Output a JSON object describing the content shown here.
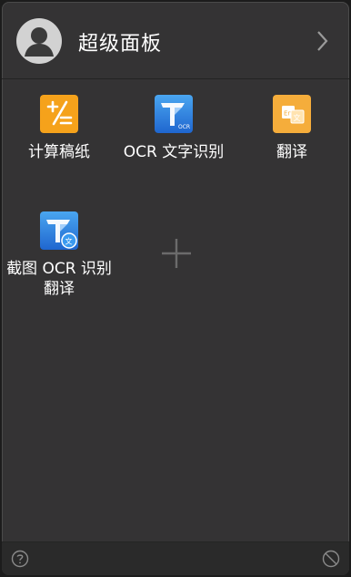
{
  "header": {
    "title": "超级面板"
  },
  "tiles": [
    {
      "label": "计算稿纸",
      "icon": "calculator-icon",
      "color": "#f5a21b"
    },
    {
      "label": "OCR 文字识别",
      "icon": "ocr-text-icon",
      "color": "#2a7fde"
    },
    {
      "label": "翻译",
      "icon": "translate-icon",
      "color": "#f5ad3b"
    },
    {
      "label": "截图 OCR 识别翻译",
      "icon": "screenshot-ocr-translate-icon",
      "color": "#2a7fde"
    }
  ],
  "ocr_badge": "OCR",
  "add_button": {
    "icon": "plus-icon"
  },
  "footer": {
    "help_icon": "question-icon",
    "disable_icon": "ban-icon"
  },
  "colors": {
    "panel_bg": "#343334",
    "footer_bg": "#2a2a2a",
    "text": "#ffffff"
  }
}
